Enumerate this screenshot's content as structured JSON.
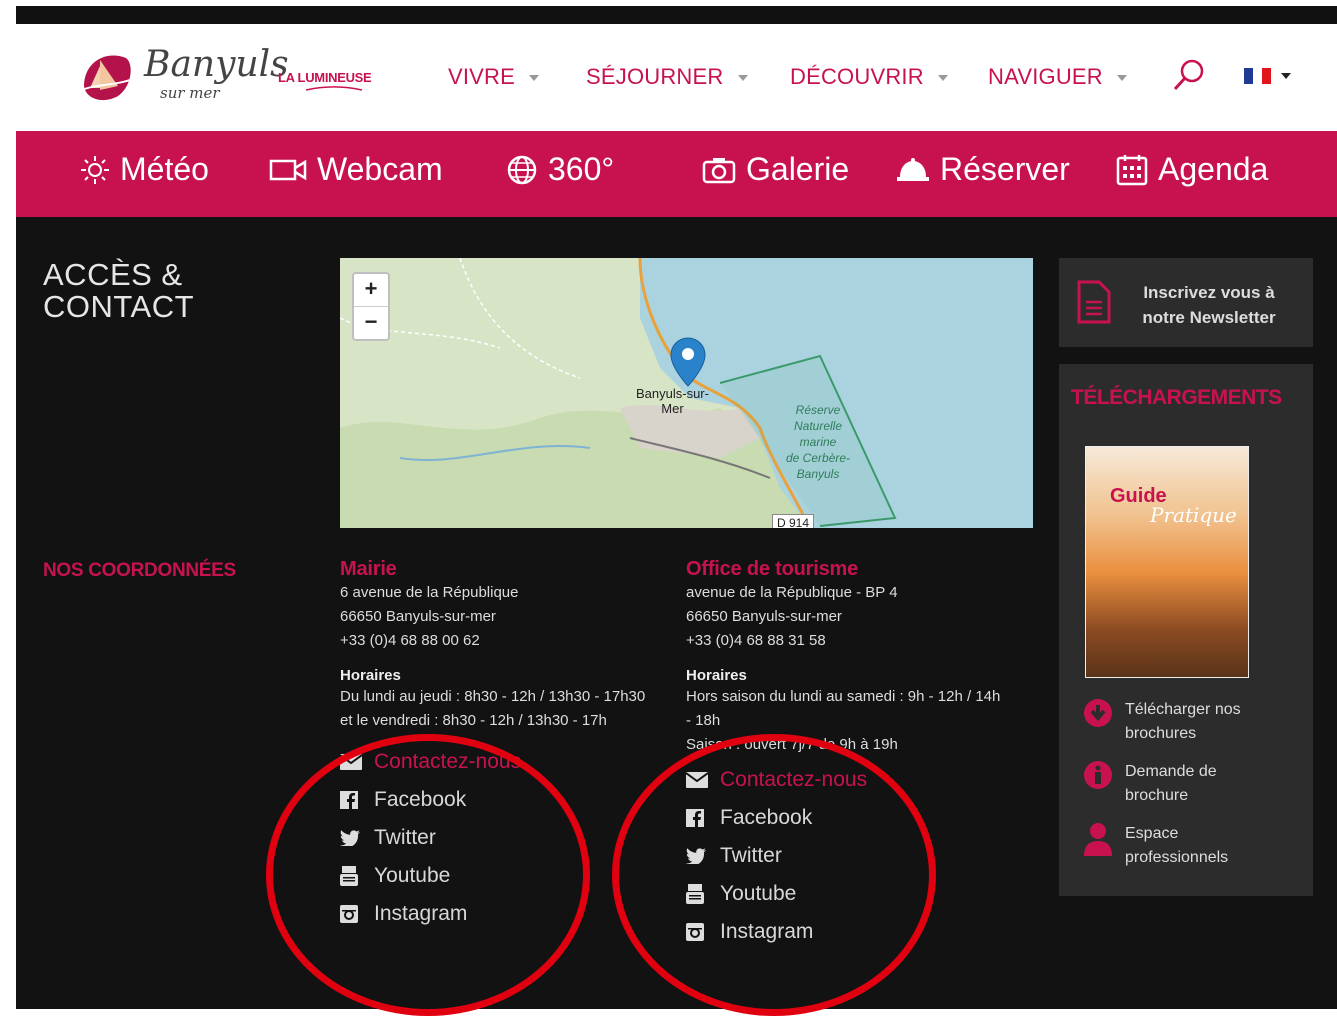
{
  "brand": {
    "logo_script": "Banyuls",
    "logo_sub": "sur mer",
    "tagline": "LA LUMINEUSE"
  },
  "nav": {
    "items": [
      {
        "label": "VIVRE"
      },
      {
        "label": "SÉJOURNER"
      },
      {
        "label": "DÉCOUVRIR"
      },
      {
        "label": "NAVIGUER"
      }
    ],
    "search_icon": "search-icon",
    "language": "french-flag-icon"
  },
  "quickbar": {
    "items": [
      {
        "label": "Météo",
        "icon": "sun-icon"
      },
      {
        "label": "Webcam",
        "icon": "camera-icon"
      },
      {
        "label": "360°",
        "icon": "globe-icon"
      },
      {
        "label": "Galerie",
        "icon": "photo-camera-icon"
      },
      {
        "label": "Réserver",
        "icon": "bell-icon"
      },
      {
        "label": "Agenda",
        "icon": "calendar-icon"
      }
    ]
  },
  "page": {
    "title": "ACCÈS & CONTACT",
    "section_label": "NOS COORDONNÉES"
  },
  "map": {
    "zoom_in": "+",
    "zoom_out": "−",
    "town_label_1": "Banyuls-sur-",
    "town_label_2": "Mer",
    "reserve_1": "Réserve",
    "reserve_2": "Naturelle",
    "reserve_3": "marine",
    "reserve_4": "de Cerbère-",
    "reserve_5": "Banyuls",
    "road": "D 914"
  },
  "mairie": {
    "title": "Mairie",
    "address1": "6 avenue de la République",
    "address2": "66650 Banyuls-sur-mer",
    "phone": "+33 (0)4 68 88 00 62",
    "hours_label": "Horaires",
    "hours": "Du lundi au jeudi : 8h30 - 12h / 13h30 - 17h30 et le vendredi : 8h30 - 12h / 13h30 - 17h",
    "links": {
      "contact": "Contactez-nous",
      "facebook": "Facebook",
      "twitter": "Twitter",
      "youtube": "Youtube",
      "instagram": "Instagram"
    }
  },
  "office": {
    "title": "Office de tourisme",
    "address1": "avenue de la République - BP 4",
    "address2": "66650 Banyuls-sur-mer",
    "phone": "+33 (0)4 68 88 31 58",
    "hours_label": "Horaires",
    "hours": "Hors saison du lundi au samedi : 9h - 12h / 14h - 18h",
    "hours2": "Saison : ouvert 7j/7 de 9h à 19h",
    "links": {
      "contact": "Contactez-nous",
      "facebook": "Facebook",
      "twitter": "Twitter",
      "youtube": "Youtube",
      "instagram": "Instagram"
    }
  },
  "newsletter": {
    "line1": "Inscrivez vous à",
    "line2": "notre Newsletter"
  },
  "downloads": {
    "title": "TÉLÉCHARGEMENTS",
    "guide_title": "Guide",
    "guide_sub": "Pratique",
    "items": [
      {
        "label1": "Télécharger nos",
        "label2": "brochures",
        "icon": "download-icon"
      },
      {
        "label1": "Demande de",
        "label2": "brochure",
        "icon": "info-icon"
      },
      {
        "label1": "Espace",
        "label2": "professionnels",
        "icon": "user-icon"
      }
    ]
  },
  "colors": {
    "brand": "#c8124f",
    "annotation": "#e10010",
    "background": "#121212"
  }
}
